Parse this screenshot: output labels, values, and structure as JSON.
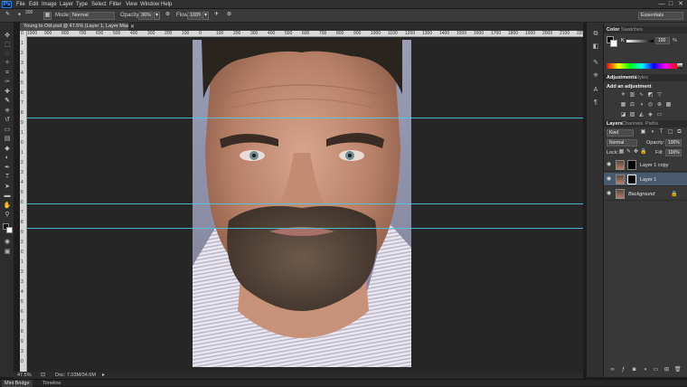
{
  "app": {
    "logo": "Ps"
  },
  "menu": [
    "File",
    "Edit",
    "Image",
    "Layer",
    "Type",
    "Select",
    "Filter",
    "View",
    "Window",
    "Help"
  ],
  "window_controls": [
    "—",
    "□",
    "✕"
  ],
  "options": {
    "brush_size": "200",
    "mode_label": "Mode:",
    "mode_value": "Normal",
    "opacity_label": "Opacity:",
    "opacity_value": "36%",
    "flow_label": "Flow:",
    "flow_value": "100%",
    "workspace": "Essentials"
  },
  "document": {
    "tab_title": "Young to Old.psd @ 47.5% (Layer 1, Layer Mask/8)",
    "zoom": "47.5%",
    "doc_info": "Doc: 7.03M/34.6M"
  },
  "rulers": {
    "top": [
      "1000",
      "900",
      "800",
      "700",
      "600",
      "500",
      "400",
      "300",
      "200",
      "100",
      "0",
      "100",
      "200",
      "300",
      "400",
      "500",
      "600",
      "700",
      "800",
      "900",
      "1000",
      "1100",
      "1200",
      "1300",
      "1400",
      "1500",
      "1600",
      "1700",
      "1800",
      "1900",
      "2000",
      "2100",
      "2200"
    ],
    "left": [
      "0",
      "1",
      "2",
      "3",
      "4",
      "5",
      "6",
      "7",
      "8",
      "9",
      "1",
      "0",
      "1",
      "2",
      "3",
      "4",
      "5",
      "6",
      "7",
      "8",
      "9",
      "2",
      "0",
      "1",
      "2",
      "3",
      "4",
      "5",
      "6",
      "7",
      "8",
      "9",
      "3",
      "0"
    ]
  },
  "bottom_tabs": [
    "Mini Bridge",
    "Timeline"
  ],
  "color_panel": {
    "tabs": [
      "Color",
      "Swatches"
    ],
    "slider_label": "K",
    "slider_value": "100",
    "unit": "%"
  },
  "adjustments_panel": {
    "tabs": [
      "Adjustments",
      "Styles"
    ],
    "heading": "Add an adjustment"
  },
  "layers_panel": {
    "tabs": [
      "Layers",
      "Channels",
      "Paths"
    ],
    "kind_label": "Kind",
    "blend_mode": "Normal",
    "opacity_label": "Opacity:",
    "opacity_value": "100%",
    "lock_label": "Lock:",
    "fill_label": "Fill:",
    "fill_value": "100%",
    "layers": [
      {
        "name": "Layer 1 copy",
        "selected": false,
        "mask": true,
        "italic": false
      },
      {
        "name": "Layer 1",
        "selected": true,
        "mask": true,
        "italic": false
      },
      {
        "name": "Background",
        "selected": false,
        "mask": false,
        "italic": true
      }
    ]
  },
  "colors": {
    "accent": "#4cc6e0",
    "selected_layer": "#4a5a6e",
    "background": "#262626"
  }
}
